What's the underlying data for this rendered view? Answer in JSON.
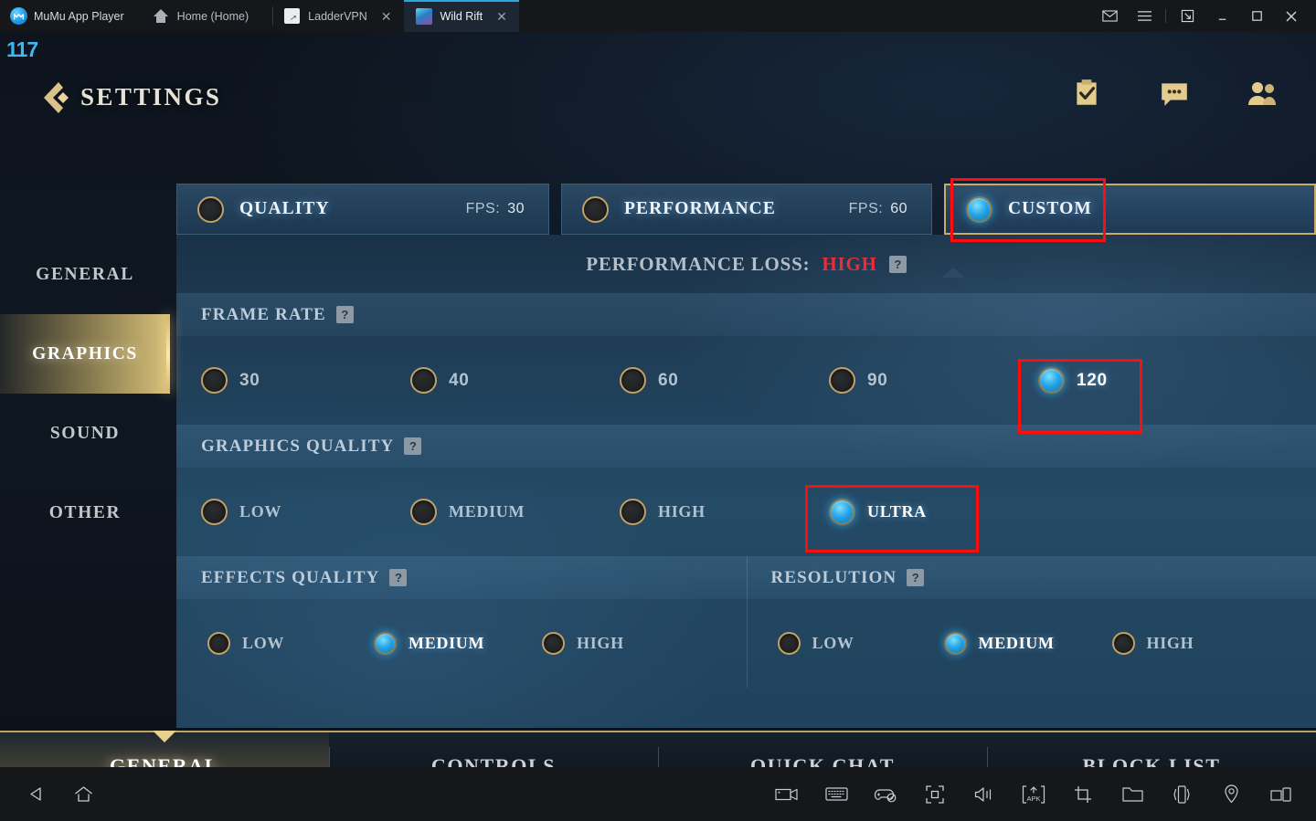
{
  "titlebar": {
    "brand": "MuMu App Player",
    "tabs": [
      {
        "label": "Home (Home)",
        "icon": "home-icon",
        "closable": false,
        "active": false
      },
      {
        "label": "LadderVPN",
        "icon": "ladder-icon",
        "closable": true,
        "active": false
      },
      {
        "label": "Wild Rift",
        "icon": "wildrift-icon",
        "closable": true,
        "active": true
      }
    ],
    "close_glyph": "✕",
    "controls": [
      {
        "name": "mail-icon",
        "glyph": "mail"
      },
      {
        "name": "menu-icon",
        "glyph": "menu"
      },
      {
        "name": "resize-icon",
        "glyph": "resize"
      },
      {
        "name": "minimize-icon",
        "glyph": "minimize"
      },
      {
        "name": "maximize-icon",
        "glyph": "maximize"
      },
      {
        "name": "close-icon",
        "glyph": "close"
      }
    ]
  },
  "game": {
    "fps_counter": "117",
    "header": {
      "title": "SETTINGS",
      "icons": [
        "mission-icon",
        "chat-icon",
        "friends-icon"
      ]
    },
    "presets": [
      {
        "label": "QUALITY",
        "fps_label": "FPS:",
        "fps_value": "30",
        "selected": false
      },
      {
        "label": "PERFORMANCE",
        "fps_label": "FPS:",
        "fps_value": "60",
        "selected": false
      },
      {
        "label": "CUSTOM",
        "fps_label": "",
        "fps_value": "",
        "selected": true
      }
    ],
    "performance_loss": {
      "label": "PERFORMANCE LOSS:",
      "value": "HIGH",
      "value_color": "#ec2b3b",
      "help_glyph": "?"
    },
    "sidebar": [
      {
        "label": "GENERAL",
        "active": false
      },
      {
        "label": "GRAPHICS",
        "active": true
      },
      {
        "label": "SOUND",
        "active": false
      },
      {
        "label": "OTHER",
        "active": false
      }
    ],
    "sections": [
      {
        "title": "FRAME RATE",
        "help_glyph": "?",
        "options": [
          {
            "label": "30",
            "selected": false
          },
          {
            "label": "40",
            "selected": false
          },
          {
            "label": "60",
            "selected": false
          },
          {
            "label": "90",
            "selected": false
          },
          {
            "label": "120",
            "selected": true
          }
        ]
      },
      {
        "title": "GRAPHICS QUALITY",
        "help_glyph": "?",
        "options": [
          {
            "label": "LOW",
            "selected": false
          },
          {
            "label": "MEDIUM",
            "selected": false
          },
          {
            "label": "HIGH",
            "selected": false
          },
          {
            "label": "ULTRA",
            "selected": true
          }
        ]
      },
      {
        "title": "EFFECTS QUALITY",
        "help_glyph": "?",
        "options": [
          {
            "label": "LOW",
            "selected": false
          },
          {
            "label": "MEDIUM",
            "selected": true
          },
          {
            "label": "HIGH",
            "selected": false
          }
        ]
      },
      {
        "title": "RESOLUTION",
        "help_glyph": "?",
        "options": [
          {
            "label": "LOW",
            "selected": false
          },
          {
            "label": "MEDIUM",
            "selected": true
          },
          {
            "label": "HIGH",
            "selected": false
          }
        ]
      }
    ],
    "bottom_tabs": [
      {
        "label": "GENERAL",
        "active": true
      },
      {
        "label": "CONTROLS",
        "active": false
      },
      {
        "label": "QUICK CHAT",
        "active": false
      },
      {
        "label": "BLOCK LIST",
        "active": false
      }
    ]
  },
  "toolbar": {
    "left": [
      "back-icon",
      "home-icon"
    ],
    "right": [
      "record-icon",
      "keyboard-icon",
      "gamepad-disabled-icon",
      "fullscreen-icon",
      "volume-icon",
      "apk-install-icon",
      "screenshot-crop-icon",
      "folder-icon",
      "shake-icon",
      "location-icon",
      "multi-window-icon"
    ]
  },
  "annotations": {
    "color": "#ff0d0d",
    "boxes": [
      "custom-preset",
      "frame-rate-120",
      "graphics-quality-ultra"
    ]
  }
}
